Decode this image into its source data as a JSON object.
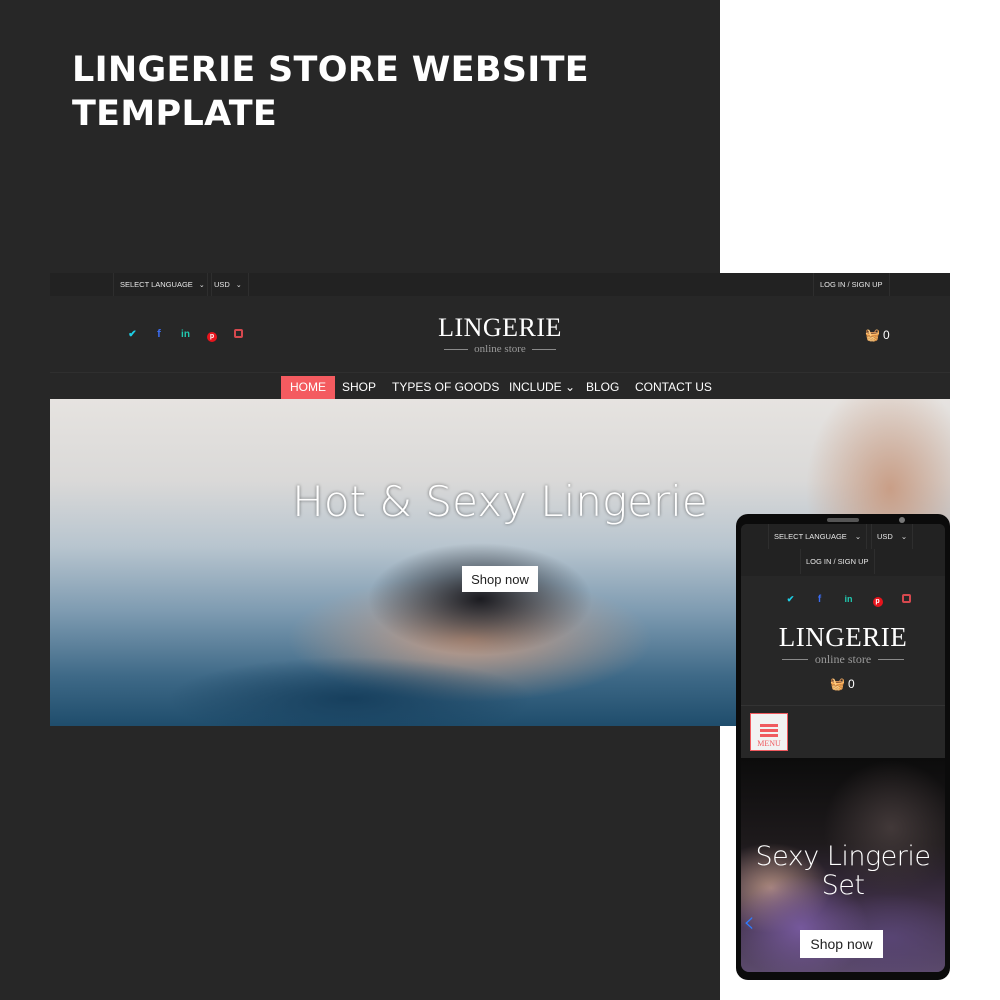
{
  "promo": {
    "title": "LINGERIE STORE WEBSITE TEMPLATE"
  },
  "desktop": {
    "topbar": {
      "language_label": "SELECT LANGUAGE",
      "currency_label": "USD",
      "login_label": "LOG IN / SIGN UP"
    },
    "social_icons": [
      {
        "name": "twitter",
        "glyph": "🐦",
        "color": "#1dcfe6"
      },
      {
        "name": "facebook",
        "glyph": "f",
        "color": "#3b6cf0"
      },
      {
        "name": "linkedin",
        "glyph": "in",
        "color": "#20c9b0"
      },
      {
        "name": "pinterest",
        "glyph": "p",
        "color": "#e8141c"
      },
      {
        "name": "instagram",
        "glyph": "◘",
        "color": "#d6484e"
      }
    ],
    "logo": {
      "name": "LINGERIE",
      "tagline": "online store"
    },
    "cart": {
      "icon": "basket-icon",
      "count": "0"
    },
    "nav": {
      "items": [
        {
          "label": "HOME",
          "active": true
        },
        {
          "label": "SHOP",
          "active": false
        },
        {
          "label": "TYPES OF GOODS",
          "active": false
        },
        {
          "label": "INCLUDE ⌄",
          "active": false
        },
        {
          "label": "BLOG",
          "active": false
        },
        {
          "label": "CONTACT US",
          "active": false
        }
      ]
    },
    "hero": {
      "title": "Hot & Sexy Lingerie",
      "button_label": "Shop now"
    }
  },
  "mobile": {
    "topbar": {
      "language_label": "SELECT LANGUAGE",
      "currency_label": "USD",
      "login_label": "LOG IN / SIGN UP"
    },
    "logo": {
      "name": "LINGERIE",
      "tagline": "online store"
    },
    "cart": {
      "count": "0"
    },
    "menu_label": "MENU",
    "hero": {
      "title": "Sexy Lingerie Set",
      "button_label": "Shop now",
      "prev_glyph": "‹"
    }
  },
  "colors": {
    "background_dark": "#272727",
    "topbar": "#222222",
    "accent": "#f45b60",
    "white": "#ffffff"
  }
}
